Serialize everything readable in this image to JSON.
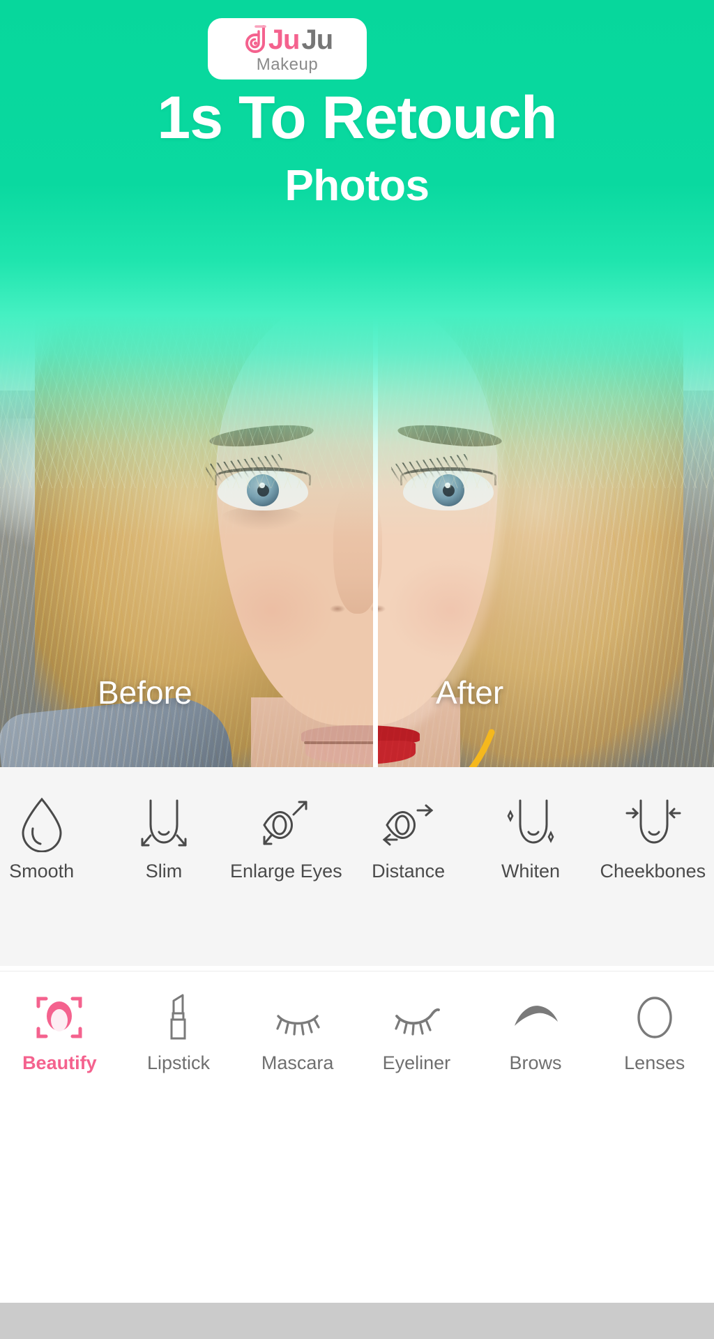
{
  "app": {
    "logo": {
      "brand_part1": "Ju",
      "brand_part2": "Ju",
      "subtitle": "Makeup",
      "pink": "#f4628e",
      "gray": "#767676"
    },
    "accent_pink": "#f4628e",
    "hero_green_top": "#07d79c",
    "hero_green_mid": "#45f0c2",
    "contour_gold": "#f5b81d"
  },
  "hero": {
    "headline": "1s To Retouch",
    "subheadline": "Photos",
    "before_label": "Before",
    "after_label": "After"
  },
  "beauty_tools": [
    {
      "label": "Smooth",
      "icon": "droplet-icon"
    },
    {
      "label": "Slim",
      "icon": "face-slim-icon"
    },
    {
      "label": "Enlarge Eyes",
      "icon": "eye-enlarge-icon"
    },
    {
      "label": "Distance",
      "icon": "eye-distance-icon"
    },
    {
      "label": "Whiten",
      "icon": "face-whiten-icon"
    },
    {
      "label": "Cheekbones",
      "icon": "cheekbones-icon"
    }
  ],
  "bottom_nav": {
    "active_index": 0,
    "items": [
      {
        "label": "Beautify",
        "icon": "face-scan-icon"
      },
      {
        "label": "Lipstick",
        "icon": "lipstick-icon"
      },
      {
        "label": "Mascara",
        "icon": "mascara-lash-icon"
      },
      {
        "label": "Eyeliner",
        "icon": "eyeliner-lash-icon"
      },
      {
        "label": "Brows",
        "icon": "eyebrow-icon"
      },
      {
        "label": "Lenses",
        "icon": "lens-circle-icon"
      }
    ]
  }
}
